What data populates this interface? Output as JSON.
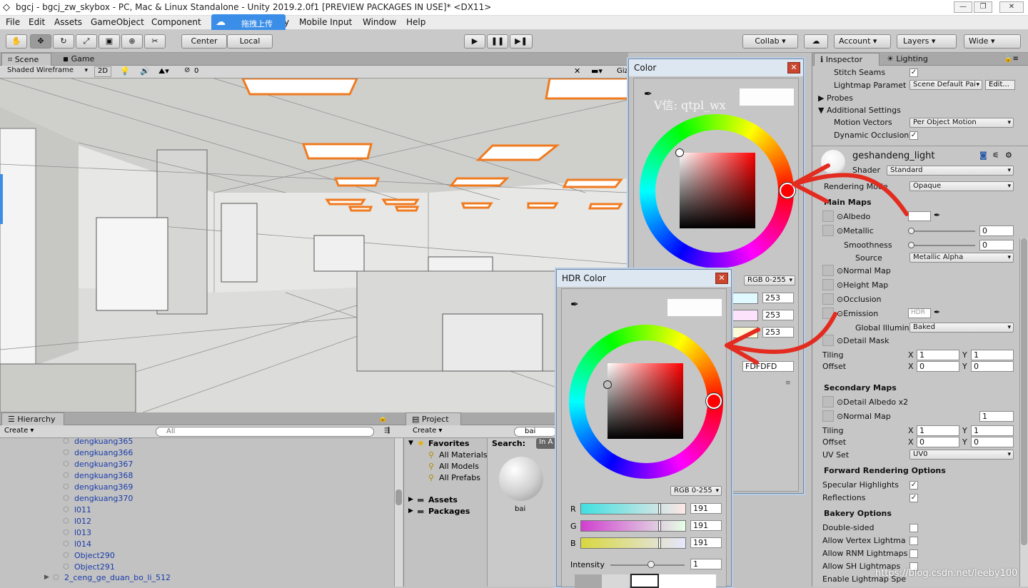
{
  "window": {
    "title": "bgcj - bgcj_zw_skybox - PC, Mac & Linux Standalone - Unity 2019.2.0f1 [PREVIEW PACKAGES IN USE]* <DX11>"
  },
  "menu": {
    "items": [
      "File",
      "Edit",
      "Assets",
      "GameObject",
      "Component",
      "y",
      "Mobile Input",
      "Window",
      "Help"
    ],
    "upload_label": "拖拽上传"
  },
  "toolbar": {
    "center": "Center",
    "local": "Local",
    "collab": "Collab",
    "account": "Account",
    "layers": "Layers",
    "layout": "Wide"
  },
  "scene": {
    "tabs": [
      "Scene",
      "Game"
    ],
    "shading": "Shaded Wireframe",
    "mode2d": "2D",
    "hidden_count": "0",
    "gizmos": "Giz"
  },
  "hierarchy": {
    "tab": "Hierarchy",
    "create": "Create",
    "search_placeholder": "All",
    "items": [
      "dengkuang365",
      "dengkuang366",
      "dengkuang367",
      "dengkuang368",
      "dengkuang369",
      "dengkuang370",
      "l011",
      "l012",
      "l013",
      "l014",
      "Object290",
      "Object291"
    ],
    "last_item": "2_ceng_ge_duan_bo_li_512"
  },
  "project": {
    "tab": "Project",
    "create": "Create",
    "search_value": "bai",
    "favorites": "Favorites",
    "fav_items": [
      "All Materials",
      "All Models",
      "All Prefabs"
    ],
    "roots": [
      "Assets",
      "Packages"
    ],
    "search_label": "Search:",
    "search_scope": "In A",
    "asset_name": "bai"
  },
  "color_window": {
    "title": "Color",
    "watermark": "V信: qtpl_wx",
    "mode": "RGB 0-255",
    "values": [
      "253",
      "253",
      "253"
    ],
    "hex": "FDFDFD"
  },
  "hdr_window": {
    "title": "HDR Color",
    "mode": "RGB 0-255",
    "channels": [
      {
        "label": "R",
        "value": "191"
      },
      {
        "label": "G",
        "value": "191"
      },
      {
        "label": "B",
        "value": "191"
      }
    ],
    "intensity_label": "Intensity",
    "intensity_value": "1"
  },
  "inspector": {
    "tabs": [
      "Inspector",
      "Lighting"
    ],
    "stitch_seams": "Stitch Seams",
    "lightmap_params": "Lightmap Paramet",
    "lightmap_params_value": "Scene Default Pai",
    "edit_button": "Edit...",
    "probes": "Probes",
    "additional_settings": "Additional Settings",
    "motion_vectors": "Motion Vectors",
    "motion_vectors_value": "Per Object Motion",
    "dynamic_occlusion": "Dynamic Occlusion",
    "material_name": "geshandeng_light",
    "shader_label": "Shader",
    "shader_value": "Standard",
    "rendering_mode": "Rendering Mode",
    "rendering_mode_value": "Opaque",
    "main_maps": "Main Maps",
    "albedo": "Albedo",
    "metallic": "Metallic",
    "metallic_value": "0",
    "smoothness": "Smoothness",
    "smoothness_value": "0",
    "source": "Source",
    "source_value": "Metallic Alpha",
    "normal_map": "Normal Map",
    "height_map": "Height Map",
    "occlusion": "Occlusion",
    "emission": "Emission",
    "hdr_badge": "HDR",
    "global_illum": "Global Illumin",
    "global_illum_value": "Baked",
    "detail_mask": "Detail Mask",
    "tiling": "Tiling",
    "offset": "Offset",
    "tiling_x": "1",
    "tiling_y": "1",
    "offset_x": "0",
    "offset_y": "0",
    "secondary_maps": "Secondary Maps",
    "detail_albedo": "Detail Albedo x2",
    "normal_map2": "Normal Map",
    "normal_map2_value": "1",
    "tiling2_x": "1",
    "tiling2_y": "1",
    "offset2_x": "0",
    "offset2_y": "0",
    "uv_set": "UV Set",
    "uv_set_value": "UV0",
    "forward_options": "Forward Rendering Options",
    "specular_highlights": "Specular Highlights",
    "reflections": "Reflections",
    "bakery_options": "Bakery Options",
    "double_sided": "Double-sided",
    "allow_vertex": "Allow Vertex Lightma",
    "allow_rnm": "Allow RNM Lightmaps",
    "allow_sh": "Allow SH Lightmaps",
    "enable_spec": "Enable Lightmap Spe"
  },
  "overlay": {
    "url": "https://blog.csdn.net/leeby100"
  },
  "colors": {
    "accent_orange": "#f07a1e",
    "annotation_red": "#e32b1f",
    "link_blue": "#1a3caa"
  }
}
